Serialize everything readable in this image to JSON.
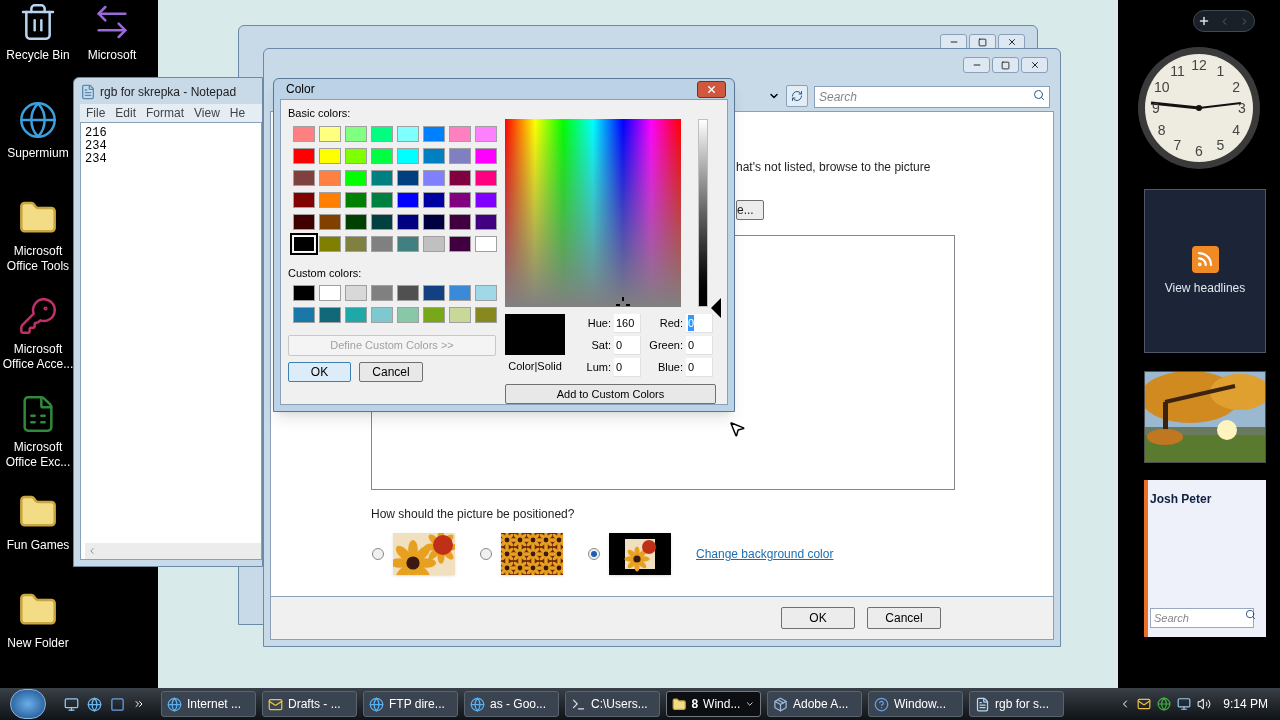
{
  "desktop": {
    "icons": [
      {
        "label": "Recycle Bin",
        "kind": "bin"
      },
      {
        "label": "Supermium",
        "kind": "browser"
      },
      {
        "label": "Microsoft Office Tools",
        "kind": "folder"
      },
      {
        "label": "Microsoft Office Acce...",
        "kind": "access"
      },
      {
        "label": "Microsoft Office Exc...",
        "kind": "excel"
      },
      {
        "label": "Fun Games",
        "kind": "folder"
      },
      {
        "label": "New Folder",
        "kind": "folder"
      }
    ],
    "icons_column_2": [
      {
        "label": "Microsoft",
        "kind": "transfer"
      }
    ]
  },
  "notepad": {
    "title": "rgb for skrepka - Notepad",
    "menu": [
      "File",
      "Edit",
      "Format",
      "View",
      "He"
    ],
    "lines": [
      "216",
      "234",
      "234"
    ]
  },
  "background_dialog": {
    "search_placeholder": "Search",
    "instruction": "hat's not listed, browse to the picture",
    "browse_button": "e...",
    "question": "How should the picture be positioned?",
    "positions": [
      {
        "kind": "stretch",
        "selected": false
      },
      {
        "kind": "tile",
        "selected": false
      },
      {
        "kind": "center",
        "selected": true
      }
    ],
    "link": "Change background color",
    "ok": "OK",
    "cancel": "Cancel"
  },
  "color_dialog": {
    "title": "Color",
    "basic_label": "Basic colors:",
    "basic_colors": [
      {
        "color": "#ff8080",
        "selected": false
      },
      {
        "color": "#ffff80",
        "selected": false
      },
      {
        "color": "#80ff80",
        "selected": false
      },
      {
        "color": "#00ff80",
        "selected": false
      },
      {
        "color": "#80ffff",
        "selected": false
      },
      {
        "color": "#0080ff",
        "selected": false
      },
      {
        "color": "#ff80c0",
        "selected": false
      },
      {
        "color": "#ff80ff",
        "selected": false
      },
      {
        "color": "#ff0000",
        "selected": false
      },
      {
        "color": "#ffff00",
        "selected": false
      },
      {
        "color": "#80ff00",
        "selected": false
      },
      {
        "color": "#00ff40",
        "selected": false
      },
      {
        "color": "#00ffff",
        "selected": false
      },
      {
        "color": "#0080c0",
        "selected": false
      },
      {
        "color": "#8080c0",
        "selected": false
      },
      {
        "color": "#ff00ff",
        "selected": false
      },
      {
        "color": "#804040",
        "selected": false
      },
      {
        "color": "#ff8040",
        "selected": false
      },
      {
        "color": "#00ff00",
        "selected": false
      },
      {
        "color": "#008080",
        "selected": false
      },
      {
        "color": "#004080",
        "selected": false
      },
      {
        "color": "#8080ff",
        "selected": false
      },
      {
        "color": "#800040",
        "selected": false
      },
      {
        "color": "#ff0080",
        "selected": false
      },
      {
        "color": "#800000",
        "selected": false
      },
      {
        "color": "#ff8000",
        "selected": false
      },
      {
        "color": "#008000",
        "selected": false
      },
      {
        "color": "#008040",
        "selected": false
      },
      {
        "color": "#0000ff",
        "selected": false
      },
      {
        "color": "#0000a0",
        "selected": false
      },
      {
        "color": "#800080",
        "selected": false
      },
      {
        "color": "#8000ff",
        "selected": false
      },
      {
        "color": "#400000",
        "selected": false
      },
      {
        "color": "#804000",
        "selected": false
      },
      {
        "color": "#004000",
        "selected": false
      },
      {
        "color": "#004040",
        "selected": false
      },
      {
        "color": "#000080",
        "selected": false
      },
      {
        "color": "#000040",
        "selected": false
      },
      {
        "color": "#400040",
        "selected": false
      },
      {
        "color": "#400080",
        "selected": false
      },
      {
        "color": "#000000",
        "selected": true
      },
      {
        "color": "#808000",
        "selected": false
      },
      {
        "color": "#808040",
        "selected": false
      },
      {
        "color": "#808080",
        "selected": false
      },
      {
        "color": "#408080",
        "selected": false
      },
      {
        "color": "#c0c0c0",
        "selected": false
      },
      {
        "color": "#400040",
        "selected": false
      },
      {
        "color": "#ffffff",
        "selected": false
      }
    ],
    "custom_label": "Custom colors:",
    "custom_colors": [
      {
        "color": "#000000"
      },
      {
        "color": "#ffffff"
      },
      {
        "color": "#d8d8d8"
      },
      {
        "color": "#808080"
      },
      {
        "color": "#505050"
      },
      {
        "color": "#124080"
      },
      {
        "color": "#3a8ad8"
      },
      {
        "color": "#a0d8e8"
      },
      {
        "color": "#1878a8"
      },
      {
        "color": "#106878"
      },
      {
        "color": "#20a8a8"
      },
      {
        "color": "#80c8d0"
      },
      {
        "color": "#88c8a8"
      },
      {
        "color": "#78a818"
      },
      {
        "color": "#c8d898"
      },
      {
        "color": "#888820"
      }
    ],
    "define_button": {
      "label": "Define Custom Colors >>",
      "disabled": true
    },
    "ok": "OK",
    "cancel": "Cancel",
    "preview_label": "Color|Solid",
    "fields": [
      {
        "label": "Hue:",
        "value": "160",
        "focused": false
      },
      {
        "label": "Red:",
        "value": "0",
        "focused": true
      },
      {
        "label": "Sat:",
        "value": "0",
        "focused": false
      },
      {
        "label": "Green:",
        "value": "0",
        "focused": false
      },
      {
        "label": "Lum:",
        "value": "0",
        "focused": false
      },
      {
        "label": "Blue:",
        "value": "0",
        "focused": false
      }
    ],
    "luminance": {
      "level": 0
    },
    "add_button": "Add to Custom Colors"
  },
  "taskbar": {
    "tasks": [
      {
        "label": "Internet ...",
        "kind": "browser",
        "selected": false
      },
      {
        "label": "Drafts - ...",
        "kind": "mail",
        "selected": false
      },
      {
        "label": "FTP dire...",
        "kind": "browser",
        "selected": false
      },
      {
        "label": "as - Goo...",
        "kind": "browser",
        "selected": false
      },
      {
        "label": "C:\\Users...",
        "kind": "console",
        "selected": false
      },
      {
        "count": "8",
        "label": "Wind...",
        "kind": "folder",
        "selected": true
      },
      {
        "label": "Adobe A...",
        "kind": "installer",
        "selected": false
      },
      {
        "label": "Window...",
        "kind": "help",
        "selected": false
      },
      {
        "label": "rgb for s...",
        "kind": "notepad",
        "selected": false
      }
    ],
    "time": "9:14 PM"
  },
  "sidebar": {
    "clock_numerals": [
      "12",
      "11",
      "1",
      "10",
      "2",
      "9",
      "3",
      "8",
      "4",
      "7",
      "5",
      "6"
    ],
    "feed": "View headlines",
    "contact": "Josh Peter",
    "search_placeholder": "Search"
  }
}
